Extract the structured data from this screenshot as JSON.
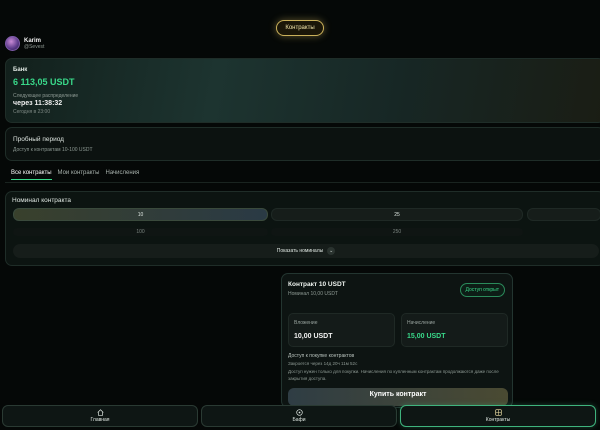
{
  "header": {
    "contracts_pill": "Контракты"
  },
  "user": {
    "name": "Karim",
    "handle": "@Sevest"
  },
  "bank": {
    "title": "Банк",
    "amount": "6 113,05 USDT",
    "next_label": "Следующее распределение",
    "next_time": "через 11:38:32",
    "today": "Сегодня в 23:00"
  },
  "trial": {
    "title": "Пробный период",
    "subtitle": "Доступ к контрактам 10-100 USDT"
  },
  "tabs": [
    "Все контракты",
    "Мои контракты",
    "Начисления"
  ],
  "nominal": {
    "title": "Номинал контракта",
    "chips": [
      "10",
      "25"
    ],
    "dim_chips": [
      "100",
      "250"
    ],
    "show_more": "Показать номиналы"
  },
  "contract": {
    "title": "Контракт 10 USDT",
    "nominal": "Номинал 10,00 USDT",
    "badge": "Доступ открыт",
    "deposit_label": "Вложение",
    "deposit_value": "10,00 USDT",
    "accrual_label": "Начисление",
    "accrual_value": "15,00 USDT",
    "info1": "Доступ к покупке контрактов",
    "info2": "Закроется через 14д 20ч 11м 52с",
    "info3": "Доступ нужен только для покупки. Начисления по купленным контрактам продолжаются даже после закрытия доступа.",
    "buy": "Купить контракт"
  },
  "nav": {
    "home": "Главная",
    "bonus": "Бафи",
    "contracts": "Контракты"
  },
  "colors": {
    "accent_green": "#39d98a",
    "gold": "#c9b05a",
    "bg": "#050807"
  }
}
